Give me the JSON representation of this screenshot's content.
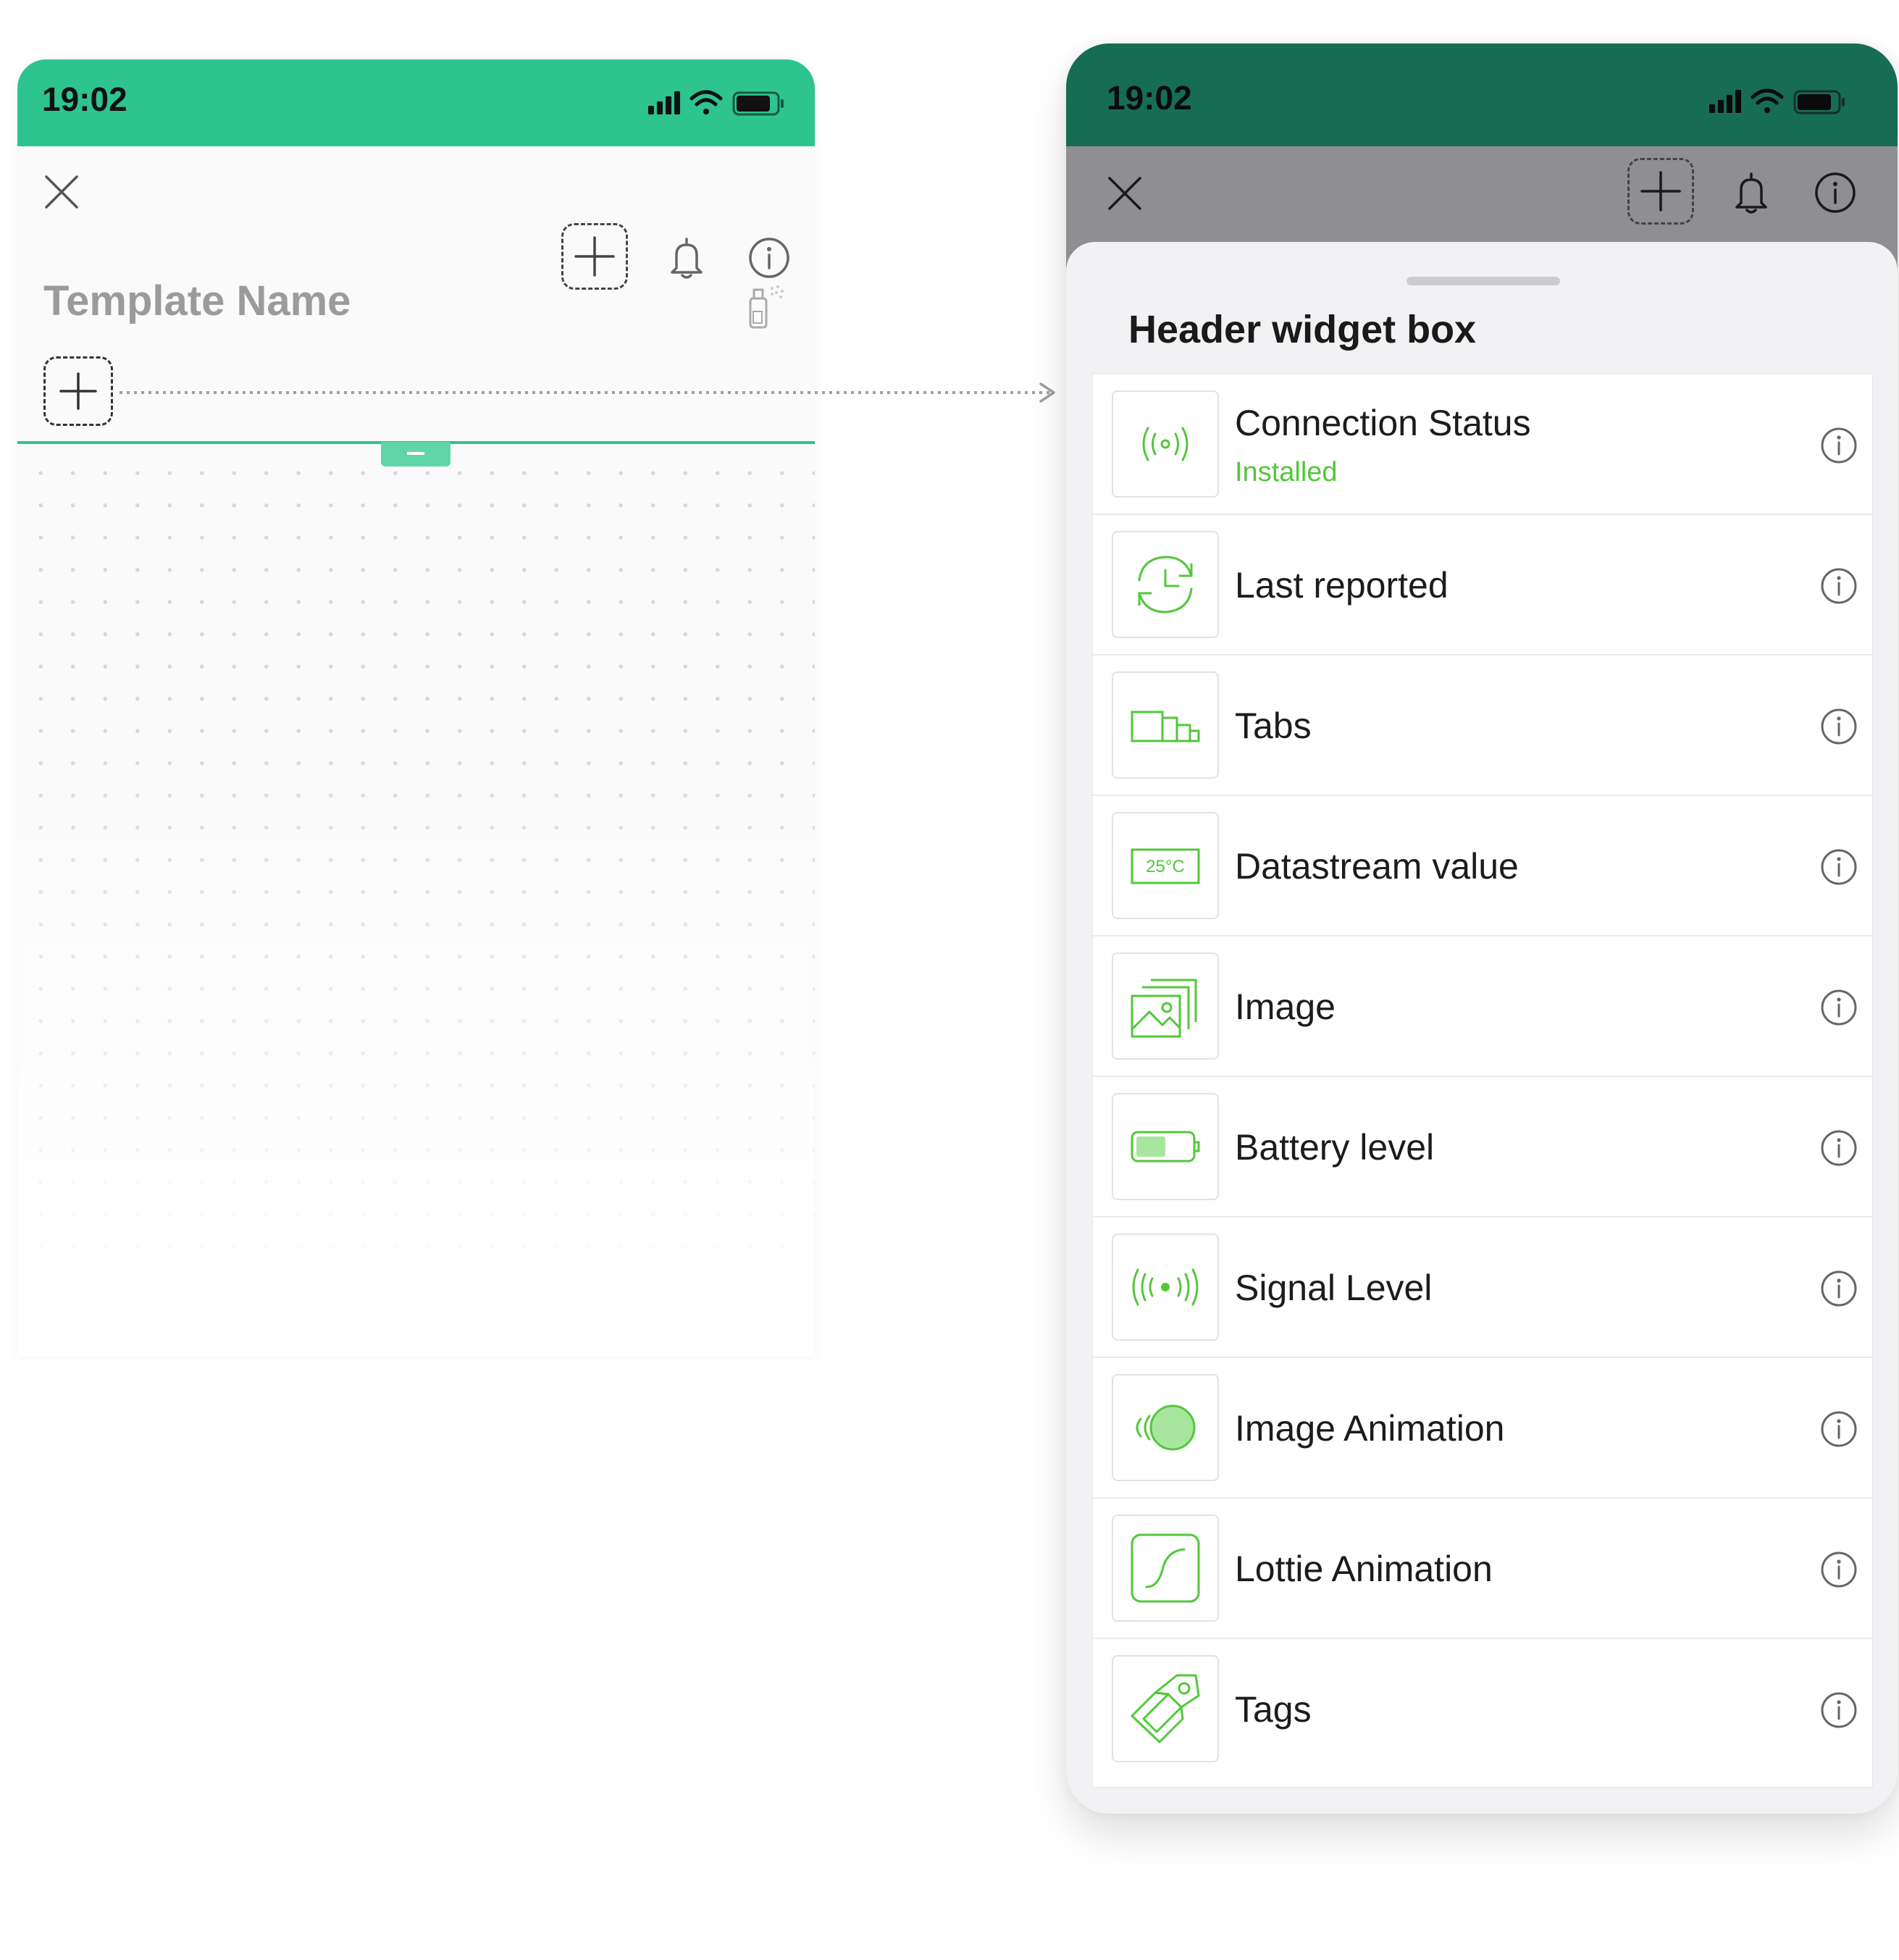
{
  "left_phone": {
    "status_time": "19:02",
    "template_name": "Template Name"
  },
  "right_phone": {
    "status_time": "19:02",
    "sheet_title": "Header widget box",
    "widgets": [
      {
        "label": "Connection Status",
        "status": "Installed",
        "icon": "connection-icon"
      },
      {
        "label": "Last reported",
        "icon": "clock-refresh-icon"
      },
      {
        "label": "Tabs",
        "icon": "tabs-icon"
      },
      {
        "label": "Datastream value",
        "icon": "datastream-icon",
        "icon_text": "25°C"
      },
      {
        "label": "Image",
        "icon": "image-icon"
      },
      {
        "label": "Battery level",
        "icon": "battery-icon"
      },
      {
        "label": "Signal Level",
        "icon": "signal-icon"
      },
      {
        "label": "Image Animation",
        "icon": "image-animation-icon"
      },
      {
        "label": "Lottie Animation",
        "icon": "lottie-icon"
      },
      {
        "label": "Tags",
        "icon": "tags-icon"
      }
    ]
  },
  "colors": {
    "left_status_bar": "#2dc48f",
    "right_status_bar": "#176c54",
    "accent_green": "#52c83a",
    "overlay": "#8e8e93"
  }
}
